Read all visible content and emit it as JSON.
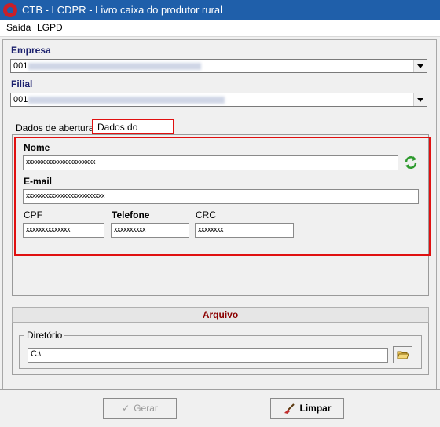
{
  "window": {
    "title": "CTB - LCDPR - Livro caixa do produtor rural"
  },
  "menu": {
    "items": [
      "Saída",
      "LGPD"
    ]
  },
  "empresa": {
    "label": "Empresa",
    "value": "001"
  },
  "filial": {
    "label": "Filial",
    "value": "001"
  },
  "tabs": [
    {
      "label": "Dados de abertura"
    },
    {
      "label": "Dados do contador"
    }
  ],
  "contador": {
    "nome_label": "Nome",
    "nome_value": "xxxxxxxxxxxxxxxxxxxxxx",
    "email_label": "E-mail",
    "email_value": "xxxxxxxxxxxxxxxxxxxxxxxxx",
    "cpf_label": "CPF",
    "cpf_value": "xxxxxxxxxxxxxx",
    "telefone_label": "Telefone",
    "telefone_value": "xxxxxxxxxx",
    "crc_label": "CRC",
    "crc_value": "xxxxxxxx"
  },
  "arquivo": {
    "header": "Arquivo",
    "diretorio_label": "Diretório",
    "diretorio_value": "C:\\"
  },
  "buttons": {
    "gerar": "Gerar",
    "limpar": "Limpar"
  },
  "colors": {
    "titlebar": "#1f5faa",
    "highlight": "#e01010",
    "section_header_text": "#8b0000"
  }
}
